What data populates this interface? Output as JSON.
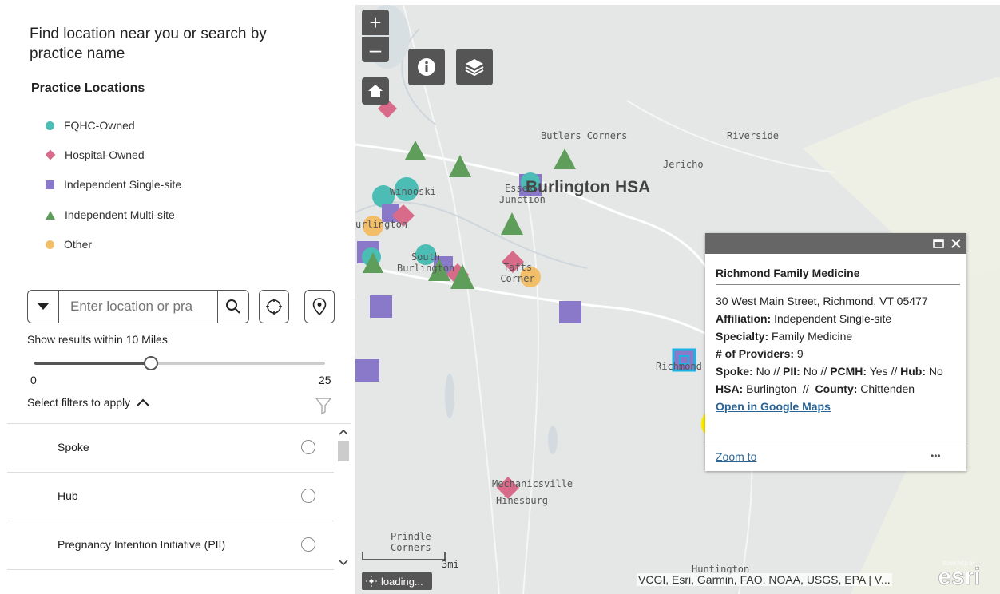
{
  "panel": {
    "intro": "Find location near you or search by practice name",
    "legend_title": "Practice Locations",
    "legend": [
      {
        "label": "FQHC-Owned",
        "color": "#4bbdb5",
        "shape": "circle"
      },
      {
        "label": "Hospital-Owned",
        "color": "#d96b8a",
        "shape": "diamond"
      },
      {
        "label": "Independent Single-site",
        "color": "#8a78c9",
        "shape": "square"
      },
      {
        "label": "Independent Multi-site",
        "color": "#5f9e5a",
        "shape": "triangle"
      },
      {
        "label": "Other",
        "color": "#f2be6a",
        "shape": "circle"
      }
    ],
    "search_placeholder": "Enter location or pra",
    "radius_label": "Show results within 10 Miles",
    "radius_value": 10,
    "radius_min": "0",
    "radius_max": "25",
    "filters_label": "Select filters to apply",
    "filters": [
      {
        "label": "Spoke"
      },
      {
        "label": "Hub"
      },
      {
        "label": "Pregnancy Intention Initiative (PII)"
      }
    ]
  },
  "map": {
    "place_labels": [
      {
        "text": "Butlers\nCorners"
      },
      {
        "text": "Riverside"
      },
      {
        "text": "Jericho"
      },
      {
        "text": "Winooski"
      },
      {
        "text": "Essex\nJunction"
      },
      {
        "text": "urlington"
      },
      {
        "text": "South\nBurlington"
      },
      {
        "text": "Tafts\nCorner"
      },
      {
        "text": "Richmond"
      },
      {
        "text": "Mechanicsville"
      },
      {
        "text": "Hinesburg"
      },
      {
        "text": "Prindle\nCorners"
      },
      {
        "text": "Huntington"
      }
    ],
    "hsa_label": "Burlington HSA",
    "scale_label": "3mi",
    "loading_text": "loading...",
    "attribution": "VCGI, Esri, Garmin, FAO, NOAA, USGS, EPA | V...",
    "esri_badge": "POWERED BY esri"
  },
  "popup": {
    "title": "Richmond Family Medicine",
    "address": "30 West Main Street, Richmond, VT 05477",
    "affiliation_label": "Affiliation:",
    "affiliation": "Independent Single-site",
    "specialty_label": "Specialty:",
    "specialty": "Family Medicine",
    "providers_label": "# of Providers:",
    "providers": "9",
    "spoke_label": "Spoke:",
    "spoke": "No",
    "sep": "//",
    "pii_label": "PII:",
    "pii": "No",
    "pcmh_label": "PCMH:",
    "pcmh": "Yes",
    "hub_label": "Hub:",
    "hub": "No",
    "hsa_label": "HSA:",
    "hsa": "Burlington",
    "county_label": "County:",
    "county": "Chittenden",
    "google_link": "Open in Google Maps",
    "zoom_link": "Zoom to",
    "more": "•••"
  },
  "colors": {
    "fqhc": "#4bbdb5",
    "hospital": "#d96b8a",
    "single": "#8a78c9",
    "multi": "#5f9e5a",
    "other": "#f2be6a",
    "highlight": "#ffee00"
  }
}
